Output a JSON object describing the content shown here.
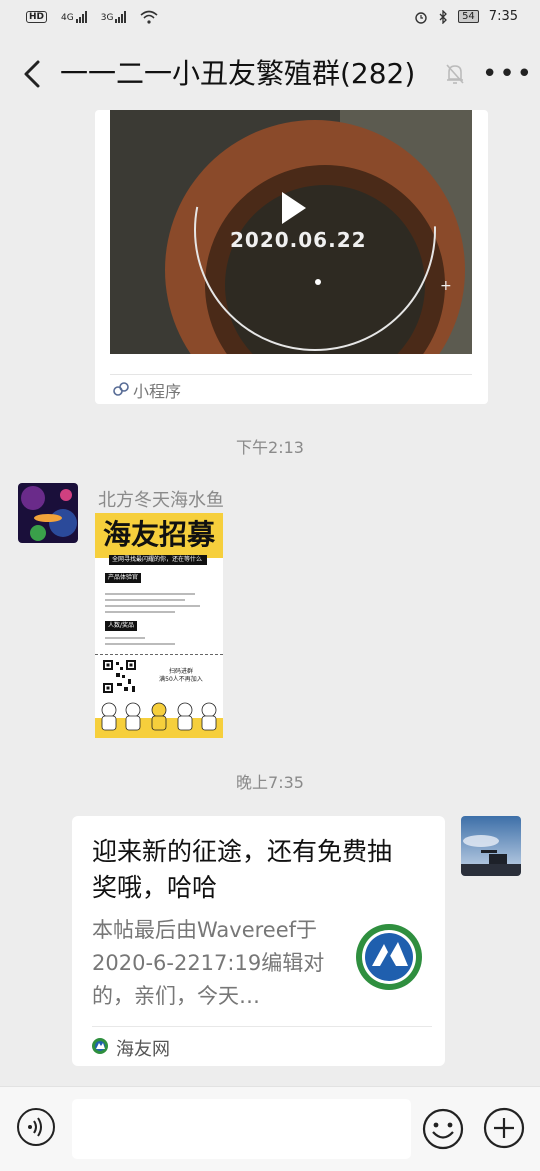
{
  "status_bar": {
    "hd": "HD",
    "net1": "4G",
    "net2": "3G",
    "battery": "54",
    "time": "7:35"
  },
  "nav": {
    "title": "一一二一小丑友繁殖群(282)",
    "back_icon": "chevron-left-icon",
    "mute_icon": "bell-off-icon",
    "more_icon": "more-icon"
  },
  "messages": {
    "mini_program": {
      "video_date": "2020.06.22",
      "label": "小程序"
    },
    "time_1": "下午2:13",
    "sender_name": "北方冬天海水鱼",
    "poster": {
      "title": "海友招募",
      "sub1": "全网寻找最闪耀的你，还在等什么",
      "tag1": "产品体验官",
      "tag2": "人数/奖品",
      "scan": "扫码进群\n满50人不再加入"
    },
    "time_2": "晚上7:35",
    "link_card": {
      "title": "迎来新的征途，还有免费抽奖哦，哈哈",
      "desc": "本帖最后由Wavereef于2020-6-2217:19编辑对的，亲们，今天…",
      "source": "海友网"
    }
  },
  "colors": {
    "accent_link": "#576b95",
    "poster_yellow": "#f6cf3c",
    "logo_green": "#2f8f3f",
    "logo_blue": "#1f5fae"
  }
}
